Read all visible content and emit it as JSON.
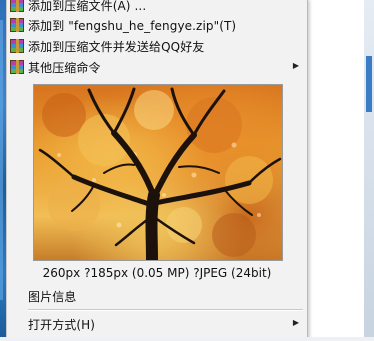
{
  "menu": {
    "items": [
      {
        "label": "添加到压缩文件(A) ...",
        "icon": "rar-archive-icon"
      },
      {
        "label": "添加到 \"fengshu_he_fengye.zip\"(T)",
        "icon": "rar-archive-icon"
      },
      {
        "label": "添加到压缩文件并发送给QQ好友",
        "icon": "rar-archive-icon"
      },
      {
        "label": "其他压缩命令",
        "icon": "rar-archive-icon",
        "has_submenu": true
      }
    ],
    "image_info": "260px ?185px (0.05 MP) ?JPEG (24bit)",
    "picture_info_label": "图片信息",
    "open_with_label": "打开方式(H)"
  },
  "colors": {
    "menu_background": "#f2f2f2",
    "separator": "#c9c9c9",
    "desktop_blue": "#2e6fb8"
  }
}
